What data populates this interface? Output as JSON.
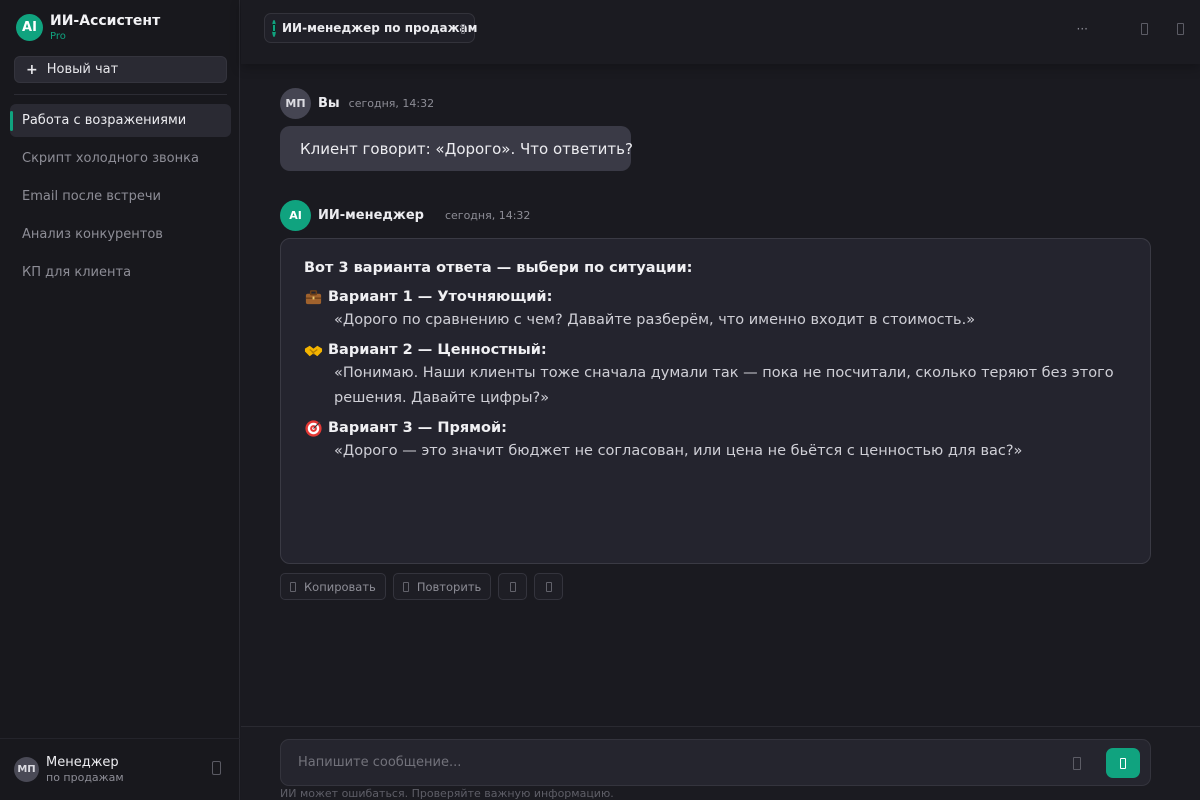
{
  "app": {
    "logo_text": "AI",
    "title": "ИИ-Ассистент",
    "plan": "Pro",
    "accent_color": "#10a37f"
  },
  "sidebar": {
    "new_chat_icon": "+",
    "new_chat_label": "Новый чат",
    "items": [
      {
        "label": "Работа с возражениями",
        "active": true
      },
      {
        "label": "Скрипт холодного звонка",
        "active": false
      },
      {
        "label": "Email после встречи",
        "active": false
      },
      {
        "label": "Анализ конкурентов",
        "active": false
      },
      {
        "label": "КП для клиента",
        "active": false
      }
    ],
    "user": {
      "initials": "МП",
      "name": "Менеджер",
      "role": "по продажам",
      "menu_icon": "settings-icon"
    }
  },
  "header": {
    "model_name": "ИИ-менеджер по продажам",
    "model_icon": "bot-icon",
    "more_label": "···",
    "action_icons": [
      "share-icon",
      "settings-icon"
    ]
  },
  "chat": {
    "user_message": {
      "initials": "МП",
      "author": "Вы",
      "time": "сегодня, 14:32",
      "text": "Клиент говорит: «Дорого». Что ответить?"
    },
    "ai_message": {
      "avatar_text": "AI",
      "author": "ИИ-менеджер",
      "time": "сегодня, 14:32",
      "intro": "Вот 3 варианта ответа — выбери по ситуации:",
      "variants": [
        {
          "icon": "briefcase-icon",
          "title": "Вариант 1 — Уточняющий:",
          "quote": "«Дорого по сравнению с чем? Давайте разберём, что именно входит в стоимость.»"
        },
        {
          "icon": "handshake-icon",
          "title": "Вариант 2 — Ценностный:",
          "quote": "«Понимаю. Наши клиенты тоже сначала думали так — пока не посчитали, сколько теряют без этого решения. Давайте цифры?»"
        },
        {
          "icon": "target-icon",
          "title": "Вариант 3 — Прямой:",
          "quote": "«Дорого — это значит бюджет не согласован, или цена не бьётся с ценностью для вас?»"
        }
      ]
    },
    "actions": {
      "copy_label": "Копировать",
      "regenerate_label": "Повторить",
      "icon_buttons": [
        "thumbs-up-icon",
        "thumbs-down-icon"
      ]
    }
  },
  "composer": {
    "placeholder": "Напишите сообщение...",
    "value": "",
    "attach_icon": "paperclip-icon",
    "send_icon": "send-icon",
    "disclaimer": "ИИ может ошибаться. Проверяйте важную информацию."
  }
}
